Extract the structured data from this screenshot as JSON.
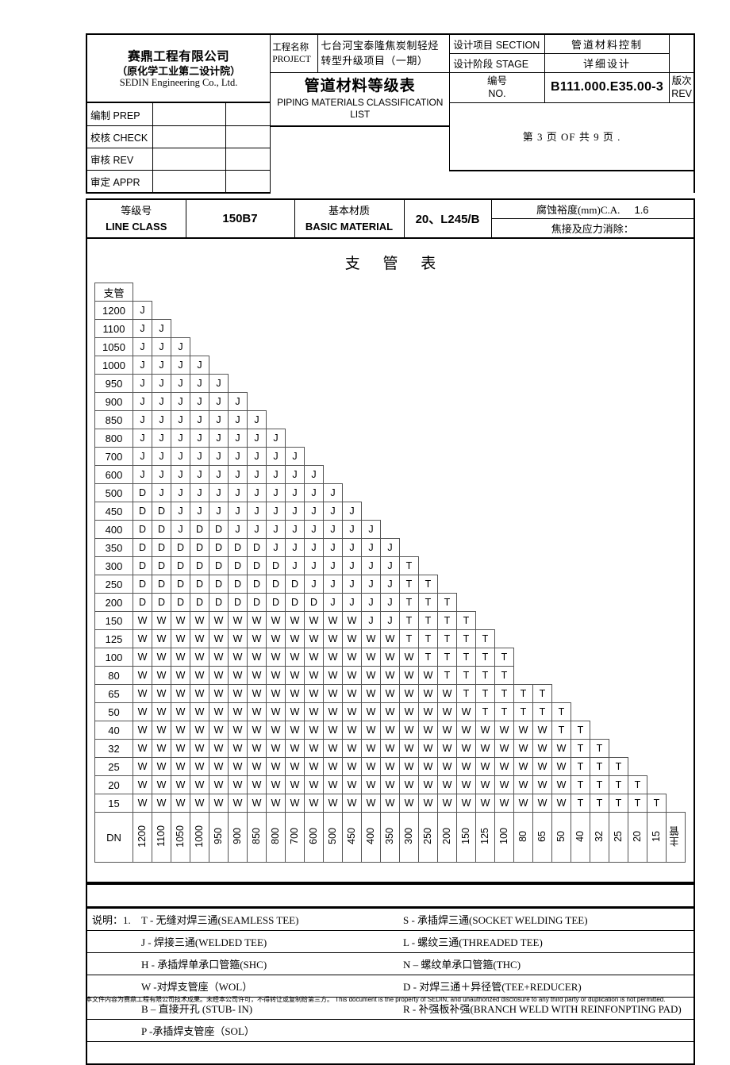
{
  "titleblock": {
    "company_cn": "赛鼎工程有限公司",
    "company_sub_cn": "（原化学工业第二设计院）",
    "company_en": "SEDIN Engineering Co., Ltd.",
    "approvals": [
      {
        "label": "编制 PREP",
        "cn": "编制",
        "en": "PREP",
        "value1": "",
        "value2": ""
      },
      {
        "label": "校核 CHECK",
        "cn": "校核",
        "en": "CHECK",
        "value1": "",
        "value2": ""
      },
      {
        "label": "审核 REV",
        "cn": "审核",
        "en": "REV",
        "value1": "",
        "value2": ""
      },
      {
        "label": "审定 APPR",
        "cn": "审定",
        "en": "APPR",
        "value1": "",
        "value2": ""
      }
    ],
    "project_label_cn": "工程名称",
    "project_label_en": "PROJECT",
    "project_value_line1": "七台河宝泰隆焦炭制轻烃",
    "project_value_line2": "转型升级项目（一期）",
    "section_label_cn": "设计项目",
    "section_label_en": "SECTION",
    "section_value": "管道材料控制",
    "stage_label_cn": "设计阶段",
    "stage_label_en": "STAGE",
    "stage_value": "详细设计",
    "doc_title_zh": "管道材料等级表",
    "doc_title_en": "PIPING MATERIALS CLASSIFICATION LIST",
    "no_label_cn": "编号",
    "no_label_en": "NO.",
    "no_value": "B111.000.E35.00-3",
    "rev_label_cn": "版次",
    "rev_label_en": "REV",
    "page_line": "第 3 页    OF     共 9 页 ."
  },
  "classbar": {
    "line_class_cn": "等级号",
    "line_class_en": "LINE CLASS",
    "line_class_value": "150B7",
    "basic_material_cn": "基本材质",
    "basic_material_en": "BASIC MATERIAL",
    "basic_material_value": "20、L245/B",
    "ca_label": "腐蚀裕度(mm)C.A.",
    "ca_value": "1.6",
    "weld_label": "焦接及应力消除："
  },
  "branch_table": {
    "title": "支 管 表",
    "branch_header": "支管",
    "dn_label": "DN",
    "main_label": "主管",
    "columns": [
      "1200",
      "1100",
      "1050",
      "1000",
      "950",
      "900",
      "850",
      "800",
      "700",
      "600",
      "500",
      "450",
      "400",
      "350",
      "300",
      "250",
      "200",
      "150",
      "125",
      "100",
      "80",
      "65",
      "50",
      "40",
      "32",
      "25",
      "20",
      "15"
    ],
    "rows": [
      {
        "dn": "1200",
        "cells": [
          "J"
        ]
      },
      {
        "dn": "1100",
        "cells": [
          "J",
          "J"
        ]
      },
      {
        "dn": "1050",
        "cells": [
          "J",
          "J",
          "J"
        ]
      },
      {
        "dn": "1000",
        "cells": [
          "J",
          "J",
          "J",
          "J"
        ]
      },
      {
        "dn": "950",
        "cells": [
          "J",
          "J",
          "J",
          "J",
          "J"
        ]
      },
      {
        "dn": "900",
        "cells": [
          "J",
          "J",
          "J",
          "J",
          "J",
          "J"
        ]
      },
      {
        "dn": "850",
        "cells": [
          "J",
          "J",
          "J",
          "J",
          "J",
          "J",
          "J"
        ]
      },
      {
        "dn": "800",
        "cells": [
          "J",
          "J",
          "J",
          "J",
          "J",
          "J",
          "J",
          "J"
        ]
      },
      {
        "dn": "700",
        "cells": [
          "J",
          "J",
          "J",
          "J",
          "J",
          "J",
          "J",
          "J",
          "J"
        ]
      },
      {
        "dn": "600",
        "cells": [
          "J",
          "J",
          "J",
          "J",
          "J",
          "J",
          "J",
          "J",
          "J",
          "J"
        ]
      },
      {
        "dn": "500",
        "cells": [
          "D",
          "J",
          "J",
          "J",
          "J",
          "J",
          "J",
          "J",
          "J",
          "J",
          "J"
        ]
      },
      {
        "dn": "450",
        "cells": [
          "D",
          "D",
          "J",
          "J",
          "J",
          "J",
          "J",
          "J",
          "J",
          "J",
          "J",
          "J"
        ]
      },
      {
        "dn": "400",
        "cells": [
          "D",
          "D",
          "J",
          "D",
          "D",
          "J",
          "J",
          "J",
          "J",
          "J",
          "J",
          "J",
          "J"
        ]
      },
      {
        "dn": "350",
        "cells": [
          "D",
          "D",
          "D",
          "D",
          "D",
          "D",
          "D",
          "J",
          "J",
          "J",
          "J",
          "J",
          "J",
          "J"
        ]
      },
      {
        "dn": "300",
        "cells": [
          "D",
          "D",
          "D",
          "D",
          "D",
          "D",
          "D",
          "D",
          "J",
          "J",
          "J",
          "J",
          "J",
          "J",
          "T"
        ]
      },
      {
        "dn": "250",
        "cells": [
          "D",
          "D",
          "D",
          "D",
          "D",
          "D",
          "D",
          "D",
          "D",
          "J",
          "J",
          "J",
          "J",
          "J",
          "T",
          "T"
        ]
      },
      {
        "dn": "200",
        "cells": [
          "D",
          "D",
          "D",
          "D",
          "D",
          "D",
          "D",
          "D",
          "D",
          "D",
          "J",
          "J",
          "J",
          "J",
          "T",
          "T",
          "T"
        ]
      },
      {
        "dn": "150",
        "cells": [
          "W",
          "W",
          "W",
          "W",
          "W",
          "W",
          "W",
          "W",
          "W",
          "W",
          "W",
          "W",
          "J",
          "J",
          "T",
          "T",
          "T",
          "T"
        ]
      },
      {
        "dn": "125",
        "cells": [
          "W",
          "W",
          "W",
          "W",
          "W",
          "W",
          "W",
          "W",
          "W",
          "W",
          "W",
          "W",
          "W",
          "W",
          "T",
          "T",
          "T",
          "T",
          "T"
        ]
      },
      {
        "dn": "100",
        "cells": [
          "W",
          "W",
          "W",
          "W",
          "W",
          "W",
          "W",
          "W",
          "W",
          "W",
          "W",
          "W",
          "W",
          "W",
          "W",
          "T",
          "T",
          "T",
          "T",
          "T"
        ]
      },
      {
        "dn": "80",
        "cells": [
          "W",
          "W",
          "W",
          "W",
          "W",
          "W",
          "W",
          "W",
          "W",
          "W",
          "W",
          "W",
          "W",
          "W",
          "W",
          "W",
          "T",
          "T",
          "T",
          "T"
        ]
      },
      {
        "dn": "65",
        "cells": [
          "W",
          "W",
          "W",
          "W",
          "W",
          "W",
          "W",
          "W",
          "W",
          "W",
          "W",
          "W",
          "W",
          "W",
          "W",
          "W",
          "W",
          "T",
          "T",
          "T",
          "T",
          "T"
        ]
      },
      {
        "dn": "50",
        "cells": [
          "W",
          "W",
          "W",
          "W",
          "W",
          "W",
          "W",
          "W",
          "W",
          "W",
          "W",
          "W",
          "W",
          "W",
          "W",
          "W",
          "W",
          "W",
          "T",
          "T",
          "T",
          "T",
          "T"
        ]
      },
      {
        "dn": "40",
        "cells": [
          "W",
          "W",
          "W",
          "W",
          "W",
          "W",
          "W",
          "W",
          "W",
          "W",
          "W",
          "W",
          "W",
          "W",
          "W",
          "W",
          "W",
          "W",
          "W",
          "W",
          "W",
          "W",
          "T",
          "T"
        ]
      },
      {
        "dn": "32",
        "cells": [
          "W",
          "W",
          "W",
          "W",
          "W",
          "W",
          "W",
          "W",
          "W",
          "W",
          "W",
          "W",
          "W",
          "W",
          "W",
          "W",
          "W",
          "W",
          "W",
          "W",
          "W",
          "W",
          "W",
          "T",
          "T"
        ]
      },
      {
        "dn": "25",
        "cells": [
          "W",
          "W",
          "W",
          "W",
          "W",
          "W",
          "W",
          "W",
          "W",
          "W",
          "W",
          "W",
          "W",
          "W",
          "W",
          "W",
          "W",
          "W",
          "W",
          "W",
          "W",
          "W",
          "W",
          "T",
          "T",
          "T"
        ]
      },
      {
        "dn": "20",
        "cells": [
          "W",
          "W",
          "W",
          "W",
          "W",
          "W",
          "W",
          "W",
          "W",
          "W",
          "W",
          "W",
          "W",
          "W",
          "W",
          "W",
          "W",
          "W",
          "W",
          "W",
          "W",
          "W",
          "W",
          "T",
          "T",
          "T",
          "T"
        ]
      },
      {
        "dn": "15",
        "cells": [
          "W",
          "W",
          "W",
          "W",
          "W",
          "W",
          "W",
          "W",
          "W",
          "W",
          "W",
          "W",
          "W",
          "W",
          "W",
          "W",
          "W",
          "W",
          "W",
          "W",
          "W",
          "W",
          "W",
          "T",
          "T",
          "T",
          "T",
          "T"
        ]
      }
    ]
  },
  "legend": {
    "prefix": "说明：1.",
    "lines": [
      {
        "left": "T - 无缝对焊三通(SEAMLESS TEE)",
        "right": "S - 承插焊三通(SOCKET WELDING TEE)"
      },
      {
        "left": "J - 焊接三通(WELDED TEE)",
        "right": "L - 螺纹三通(THREADED TEE)"
      },
      {
        "left": "H - 承插焊单承口管箍(SHC)",
        "right": "N – 螺纹单承口管箍(THC)"
      },
      {
        "left": "W -对焊支管座（WOL）",
        "right": "D - 对焊三通＋异径管(TEE+REDUCER)"
      },
      {
        "left": "B – 直接开孔 (STUB- IN)",
        "right": "R - 补强板补强(BRANCH WELD WITH REINFONPTING PAD)"
      },
      {
        "left": "P -承插焊支管座（SOL）",
        "right": ""
      }
    ]
  },
  "footer": {
    "zh": "本文件内容为赛鼎工程有限公司技术成果。未经本公司许可，不得转让或复制给第三方。",
    "en": "This document is the property of SEDIN, and unauthorized disclosure to any third party or duplication is not permitted."
  }
}
